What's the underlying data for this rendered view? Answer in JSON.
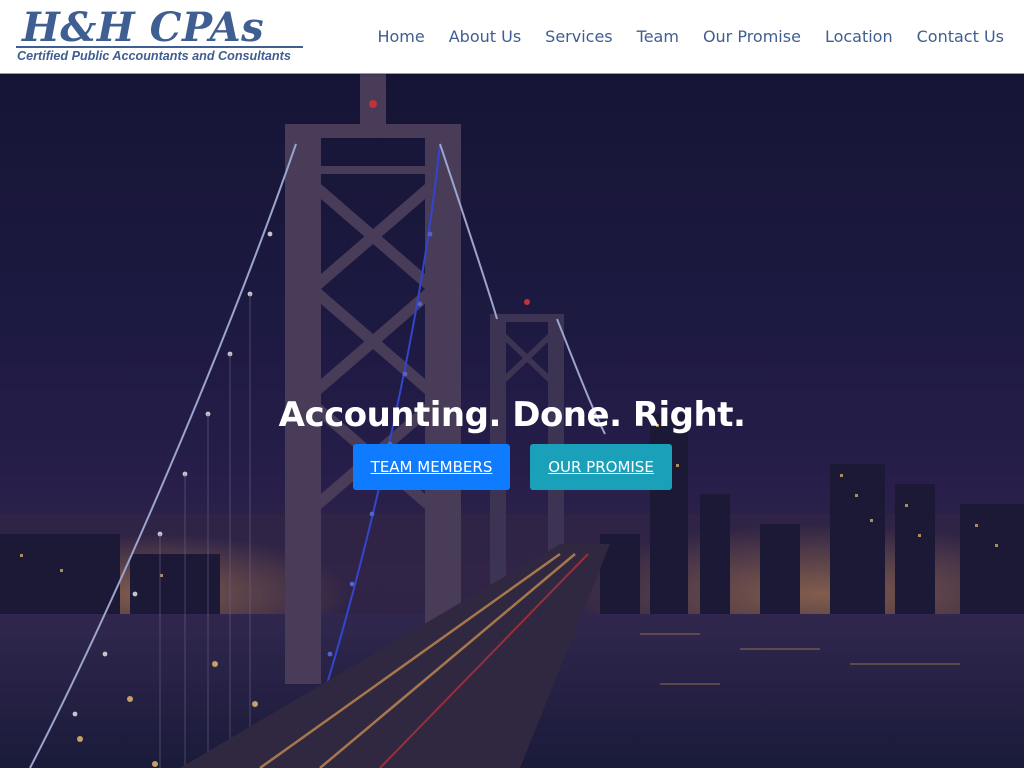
{
  "brand": {
    "title": "H&H CPAs",
    "subtitle": "Certified Public Accountants and Consultants",
    "color": "#3f5e91"
  },
  "nav": {
    "items": [
      {
        "label": "Home"
      },
      {
        "label": "About Us"
      },
      {
        "label": "Services"
      },
      {
        "label": "Team"
      },
      {
        "label": "Our Promise"
      },
      {
        "label": "Location"
      },
      {
        "label": "Contact Us"
      }
    ]
  },
  "hero": {
    "headline": "Accounting. Done. Right.",
    "buttons": {
      "team": {
        "label": "TEAM MEMBERS",
        "color": "#0f7bff"
      },
      "promise": {
        "label": "OUR PROMISE",
        "color": "#1aa0b8"
      }
    }
  }
}
